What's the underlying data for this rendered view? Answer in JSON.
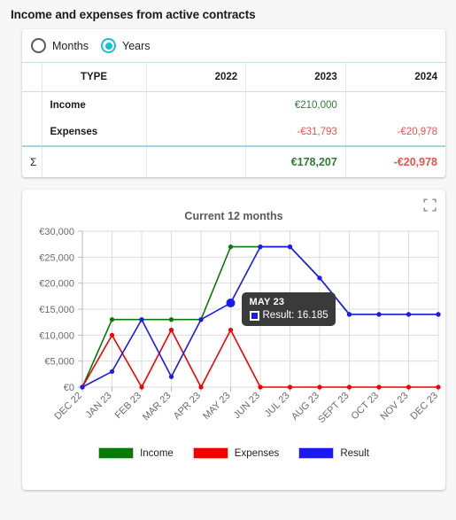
{
  "page": {
    "title": "Income and expenses from active contracts"
  },
  "toggle": {
    "options": [
      {
        "label": "Months",
        "checked": false,
        "name": "radio-months"
      },
      {
        "label": "Years",
        "checked": true,
        "name": "radio-years"
      }
    ],
    "accent_color": "#20bcd4"
  },
  "table": {
    "sigma_symbol": "Σ",
    "headers": [
      "",
      "TYPE",
      "2022",
      "2023",
      "2024"
    ],
    "rows": [
      {
        "type": "Income",
        "2022": "",
        "2023": "€210,000",
        "2024": "",
        "c2022": "",
        "c2023": "pos",
        "c2024": ""
      },
      {
        "type": "Expenses",
        "2022": "",
        "2023": "-€31,793",
        "2024": "-€20,978",
        "c2022": "",
        "c2023": "neg",
        "c2024": "neg"
      }
    ],
    "total": {
      "2022": "",
      "2023": "€178,207",
      "2024": "-€20,978",
      "c2023": "pos",
      "c2024": "neg"
    }
  },
  "chart_card": {
    "expand_icon": "fullscreen-expand-icon"
  },
  "tooltip": {
    "title": "MAY 23",
    "series_label": "Result: 16.185",
    "marker_color": "#1a1aee"
  },
  "chart_data": {
    "type": "line",
    "title": "Current 12 months",
    "xlabel": "",
    "ylabel": "",
    "ylim": [
      0,
      30000
    ],
    "yticks": [
      0,
      5000,
      10000,
      15000,
      20000,
      25000,
      30000
    ],
    "ytick_labels": [
      "€0",
      "€5,000",
      "€10,000",
      "€15,000",
      "€20,000",
      "€25,000",
      "€30,000"
    ],
    "grid": true,
    "legend_position": "bottom",
    "categories": [
      "DEC 22",
      "JAN 23",
      "FEB 23",
      "MAR 23",
      "APR 23",
      "MAY 23",
      "JUN 23",
      "JUL 23",
      "AUG 23",
      "SEPT 23",
      "OCT 23",
      "NOV 23",
      "DEC 23"
    ],
    "series": [
      {
        "name": "Income",
        "color": "#087908",
        "values": [
          0,
          13000,
          13000,
          13000,
          13000,
          27000,
          27000,
          27000,
          21000,
          14000,
          14000,
          14000,
          14000
        ]
      },
      {
        "name": "Expenses",
        "color": "#f40000",
        "values": [
          0,
          10000,
          0,
          11000,
          0,
          11000,
          0,
          0,
          0,
          0,
          0,
          0,
          0
        ]
      },
      {
        "name": "Result",
        "color": "#1a1aee",
        "values": [
          0,
          3000,
          13000,
          2000,
          13000,
          16185,
          27000,
          27000,
          21000,
          14000,
          14000,
          14000,
          14000
        ]
      }
    ],
    "highlight": {
      "series": "Result",
      "index": 5,
      "value": 16185
    }
  }
}
